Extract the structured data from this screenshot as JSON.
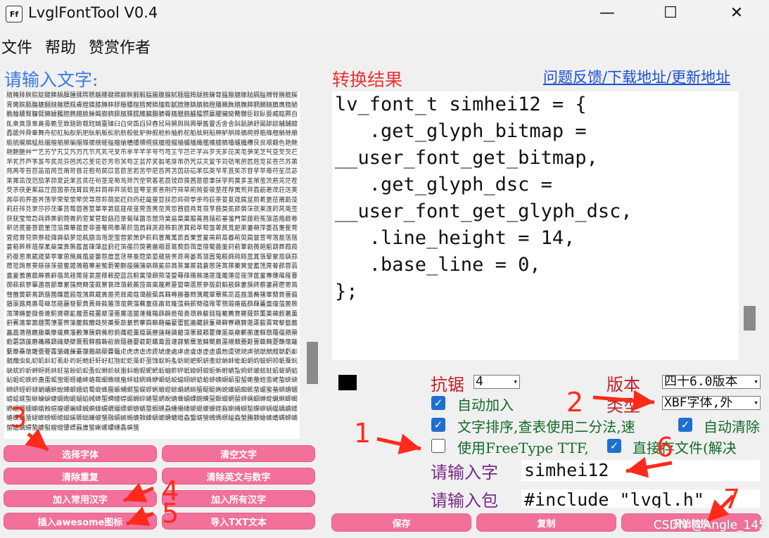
{
  "window": {
    "title": "LvglFontTool V0.4",
    "icon_text": "Ff",
    "minimize": "—",
    "maximize": "☐",
    "close": "✕"
  },
  "menu": [
    "文件",
    "帮助",
    "赞赏作者"
  ],
  "left": {
    "label": "请输入文字:",
    "text": "腈腌腓腴腙腚腱腠腡腪腫腬腭腮腯腰腱腲腳腴腵腶腷腸腹腺腻腼腽腾腿膀膁膂膃膄膅膆膇膈膉膊膋膌膍膎膏膐膑膒膓膔膕膖膗膘膙膚膛膜膝膞膟膠膡膢膣膤膥膦膧膨膩膪膫膬膭膮膯膰膱膲膳膴膵膶膷膸膹膺膻膼膽膾膿臀臁臂臃臄臅臆臇臈臉臊臋臌臍臎臏臐臑臒臓臔臕臖臗臘臙臚臛臜臝臞臟臠臡臢臣臤臥臦臧臨臩自臫臬臭臮臯臰臱臲至致臵臶臷臸臹臺臻臼臽臾臿舀舁舂舃舄舅舆與興舉舊舋舌舍舎舏舐舑舒舓舔舕舖舗舘舙舚舛舜舝舞舟舠舡舢舣舤舥舦舧舨舩航舫般舭舮舯舰舱舲舳舴舵舶舷舸船舺舻舼舽舾舿艀艁艂艃艄艅艆艇艈艉艊艋艌艍艎艏艐艑艒艓艔艕艖艗艘艙艚艛艜艝艞艟艠艡艢艣艤艥艦艧艨艩艪艫艬艭艮良艰艱色艳艴艵艶艷艸艹艺艻艼艽艾艿芀芁节芃芄芅芆芇芈芉芊芋芌芍芎芏芐芑芒芓芔芕芖芗芘芙芚芛芜芝芞芟芠芡芢芣芤芥芦芧芨芩芪芫芬芭芮芯芰花芲芳芴芵芶芷芸芹芺芻芼芽芾芿苀苁苂苃苄苅苆苇苈苉苊苋苌苍苎苏苐苑苒苓苔苕苖苗苘苙苚苛苜苝苞苟苠苡苢苣苤若苦苧苨苩苪苫苬苭苮苯苰英苲苳苴苵苶苷苸苹苺苻苼苽苾苿茀茁茂范茄茅茆茇茈茉茊茋茌茍茎茏茐茑茒茓茔茕茖茗茘茙茚茛茜茝茞茟茠茡茢茣茤茥茦茧茨茩茪茫茬茭茮茯茰茱茲茳茴茵茶茷茸茹茺茻茼茽茾茿荀荁荂荃荄荅荆荇荈草荊荋荌荍荎荏荐荑荒荓荔荕荖荗荘荙荚荛荜荝荞荟荠荡荢荣荤荥荦荧荨荩荪荫荬荭荮药荰荱荲荳荴荵荶荷荸荹荺荻荼荽荾荿莀莁莂莃莄莅莆莇莈莉莊莋莌莍莎莏莐莑莒莓莔莕莖莗莘莙莚莛莜莝莞莟莠莡莢莣莤莥莦莧莨莩莪莫莬莭莮莯莰莱莲莳莴莵莶获莸莹莺莻莼莽莾莿菀菁菂菃菄菅菆菇菈菉菊菋菌菍菎菏菐菑菒菓菔菕菖菗菘菙菚菛菜菝菞菟菠菡菢菣菤菥菦菧菨菩菪菫菬菭菮華菰菱菲菳菴菵菶菷菸菹菺菻菼菽菾菿萀萁萂萃萄萅萆萇萈萉萊萋萌萍萎萏萐萑萒萓萔萕萖萗萘萙萚萛萜萝萞萟萠萡萢萣萤营萦萧萨萩萪萫萬萭萮萯萰萱萲萳萴萵萶萷萸萹萺萻萼落萾萿葀葁葂葃葄葅葆葇葈葉葊葋葌葍葎葏葐葑葒葓葔葕葖著葘葙葚葛葜葝葞葟葠葡葢董葤葥葦葧葨葩葪葫葬葭葮葯葰葱葲葳葴葵葶葷葸葹葺葻葼葽葾葿蒀蒁蒂蒃蒄蒅蒆蒇蒈蒉蒊蒋蒌蒍蒎蒏蒐蒑蒒蒓蒔蒕蒖蒗蒘蒙蒚蒛蒜蒝蒞蒟蒠蒡蒢蒣蒤蒥蒦蒧蒨蒩蒪蒫蒬蒭蒮蒯蒰蒱蒲蒳蒴蒵蒶蒷蒸蒹蒺蒻蒼蒽蒾蒿蓀蓁蓂蓃蓄蓅蓆蓇蓈蓉蓊蓋蓌蓍蓎蓏蓐蓑蓒蓓蓔蓕蓖蓗蓘蓙蓚蓛蓜蓝蓞蓟蓠蓡蓢蓣蓤蓥蓦蓧蓨蓩蓪蓫蓬蓭蓮蓯蓰蓱蓲蓳蓴蓵蓶蓷蓸蓹蓺蓻蓼蓽蓾蓿蔀蔁蔂蔃蔄蔅蔆蔇蔈蔉蔊蔋蔌蔍蔎蔏蔐蔑蔒蔓蔔蔕蔖蔗蔘蔙蔚蔛蔜蔝蔞蔟蔠蔡蔢蔣蔤蔥蔦蔧蔨蔩蔪蔫蔬蔭蔮蔯蔰蔱蔲蔳蔴蔵蔶蔷蔸蔹蔺蔻蔼蔽蔾蔿蕀蕁蕂蕃蕄蕅蕆蕇蕈蕉蕊蕋蕌蕍蕎蕏蕐蕑蕒蕓蕔蕕蕖蕗蕘蕙蕚蕛蕜蕝蕞蕟蕠蕡蕢蕣蕤蕥蕦蕧蕨蕩蕪蕫蕬蕭蕮蕯蕰蕱蕲蕳蕴蕵蕶蕷蕸蕹蕺蕻蕼蕽蕾蕿薀薁薂薃薄薅薆薇薈薉薊薋薌薍薎薏薐薑薒薓薔薕薖薗薘薙薚薛薜薝薞薟薠薡薢薣薤薥薦薧薨薩薪薫薬薭薮薯薰薱薲薳薴薵薶薷薸薹薺薻薼薽薾薿藀藁藂藃藄藅藆藇藈藉藊藋藌藍藎藏藐藑藒藓藔藕藖藗藘藙藚藛藜藝藞藟藠藡藢藣藤藥藦藧藨藩藪藫藬藭藮藯藰藱藲藳藴藵藶藷藸藹藺藻藼藽藾藿蘀蘁蘂蘃蘄蘅蘆蘇蘈蘉蘊蘋蘌蘍蘎蘏蘐蘑蘒蘓蘔蘕蘖蘗蘘蘙蘚蘛蘜蘝蘞蘟蘠蘡蘢蘣蘤蘥蘦蘧蘨蘩蘪蘫蘬蘭蘮蘯蘰蘱蘲蘳蘴蘵蘶蘷蘸蘹蘺蘻蘼蘽蘾蘿虀虁虂虃虄虅虆虇虈虉虊虋虌虍虎虏虐虑虒虓虔處虖虗虘虙虚虛虜虝虞號虠虡虢虣虤虥虦虧虨虩虪虫虬虭虮虯虰虱虲虳虴虵虶虷虸虹虺虻虼虽虾虿蚀蚁蚂蚃蚄蚅蚆蚇蚈蚉蚊蚋蚌蚍蚎蚏蚐蚑蚒蚓蚔蚕蚖蚗蚘蚙蚚蚛蚜蚝蚞蚟蚠蚡蚢蚣蚤蚥蚦蚧蚨蚩蚪蚫蚬蚭蚮蚯蚰蚱蚲蚳蚴蚵蚶蚷蚸蚹蚺蚻蚼蚽蚾蚿蛀蛁蛂蛃蛄蛅蛆蛇蛈蛉蛊蛋蛌蛍蛎蛏蛐蛑蛒蛓蛔蛕蛖蛗蛘蛙蛚蛛蛜蛝蛞蛟蛠蛡蛢蛣蛤蛥蛦蛧蛨蛩蛪蛫蛬蛭蛮蛯蛰蛱蛲蛳蛴蛵蛶蛷蛸蛹蛺蛻蛼蛽蛾蛿蜀蜁蜂蜃蜄蜅蜆蜇蜈蜉蜊蜋蜌蜍蜎蜏蜐蜑蜒蜓蜔蜕蜖蜗蜘蜙蜚蜛蜜蜝蜞蜟蜠蜡蜢蜣蜤蜥蜦蜧蜨蜩蜪蜫蜬蜭蜮蜯蜰蜱蜲蜳蜴蜵蜶蜷蜸蜹蜺蜻蜼蜽蜾蜿蝀蝁蝂蝃蝄蝅蝆蝇蝈蝉蝊蝋蝌蝍蝎蝏蝐蝑蝒蝓蝔蝕蝖蝗蝘蝙蝚蝛蝜蝝蝞蝟蝠蝡蝢蝣蝤蝥蝦蝧蝨蝩蝪蝫蝬蝭蝮蝯蝰蝱蝲蝳蝴蝵蝶蝷蝸蝹蝺蝻蝼蝽蝾蝿螀螁螂螃螄螅螆螇螈螉螊螋螌融螎螏螐螑螒螓螔螕螖螗螘螙螚螛螜螝螞螟螠螡螢螣螤螥螦螧螨螩螪螫螬螭螮螯螰螱螲螳螴螵螶螷螸螹螺螻螼螽螾螿",
    "scroll": {
      "position": 0.82
    }
  },
  "buttons_left": [
    [
      "选择字体",
      "清空文字"
    ],
    [
      "清除重复",
      "清除英文与数字"
    ],
    [
      "加入常用汉字",
      "加入所有汉字"
    ],
    [
      "插入awesome图标",
      "导入TXT文本"
    ]
  ],
  "right": {
    "label": "转换结果",
    "link": "问题反馈/下载地址/更新地址",
    "code_lines": [
      "lv_font_t simhei12 = {",
      "   .get_glyph_bitmap =",
      "__user_font_get_bitmap,",
      "   .get_glyph_dsc =",
      "__user_font_get_glyph_dsc,",
      "   .line_height = 14,",
      "   .base_line = 0,",
      "};"
    ],
    "scroll": {
      "position": 0.88
    }
  },
  "options": {
    "antialias_label": "抗锯",
    "antialias_value": "4",
    "version_label": "版本",
    "version_value": "四十6.0版本",
    "type_label": "类型",
    "type_value": "XBF字体,外",
    "auto_add": "自动加入",
    "sort_text": "文字排序,查表使用二分法,速",
    "auto_clear": "自动清除",
    "freetype": "使用FreeType TTF,",
    "direct_save": "直接存文件(解决",
    "name_label": "请输入字",
    "name_value": "simhei12",
    "include_label": "请输入包",
    "include_value": "#include \"lvgl.h\""
  },
  "buttons_bottom": [
    "保存",
    "复制",
    "开始转换"
  ],
  "annotations": [
    "1",
    "2",
    "3",
    "4",
    "5",
    "6",
    "7"
  ],
  "watermark": "CSDN @Angle_145",
  "colors": {
    "accent_pink": "#f2709a",
    "red_anno": "#ff2a1a",
    "link_blue": "#1a4fd4",
    "input_label_blue": "#3a78e8"
  }
}
